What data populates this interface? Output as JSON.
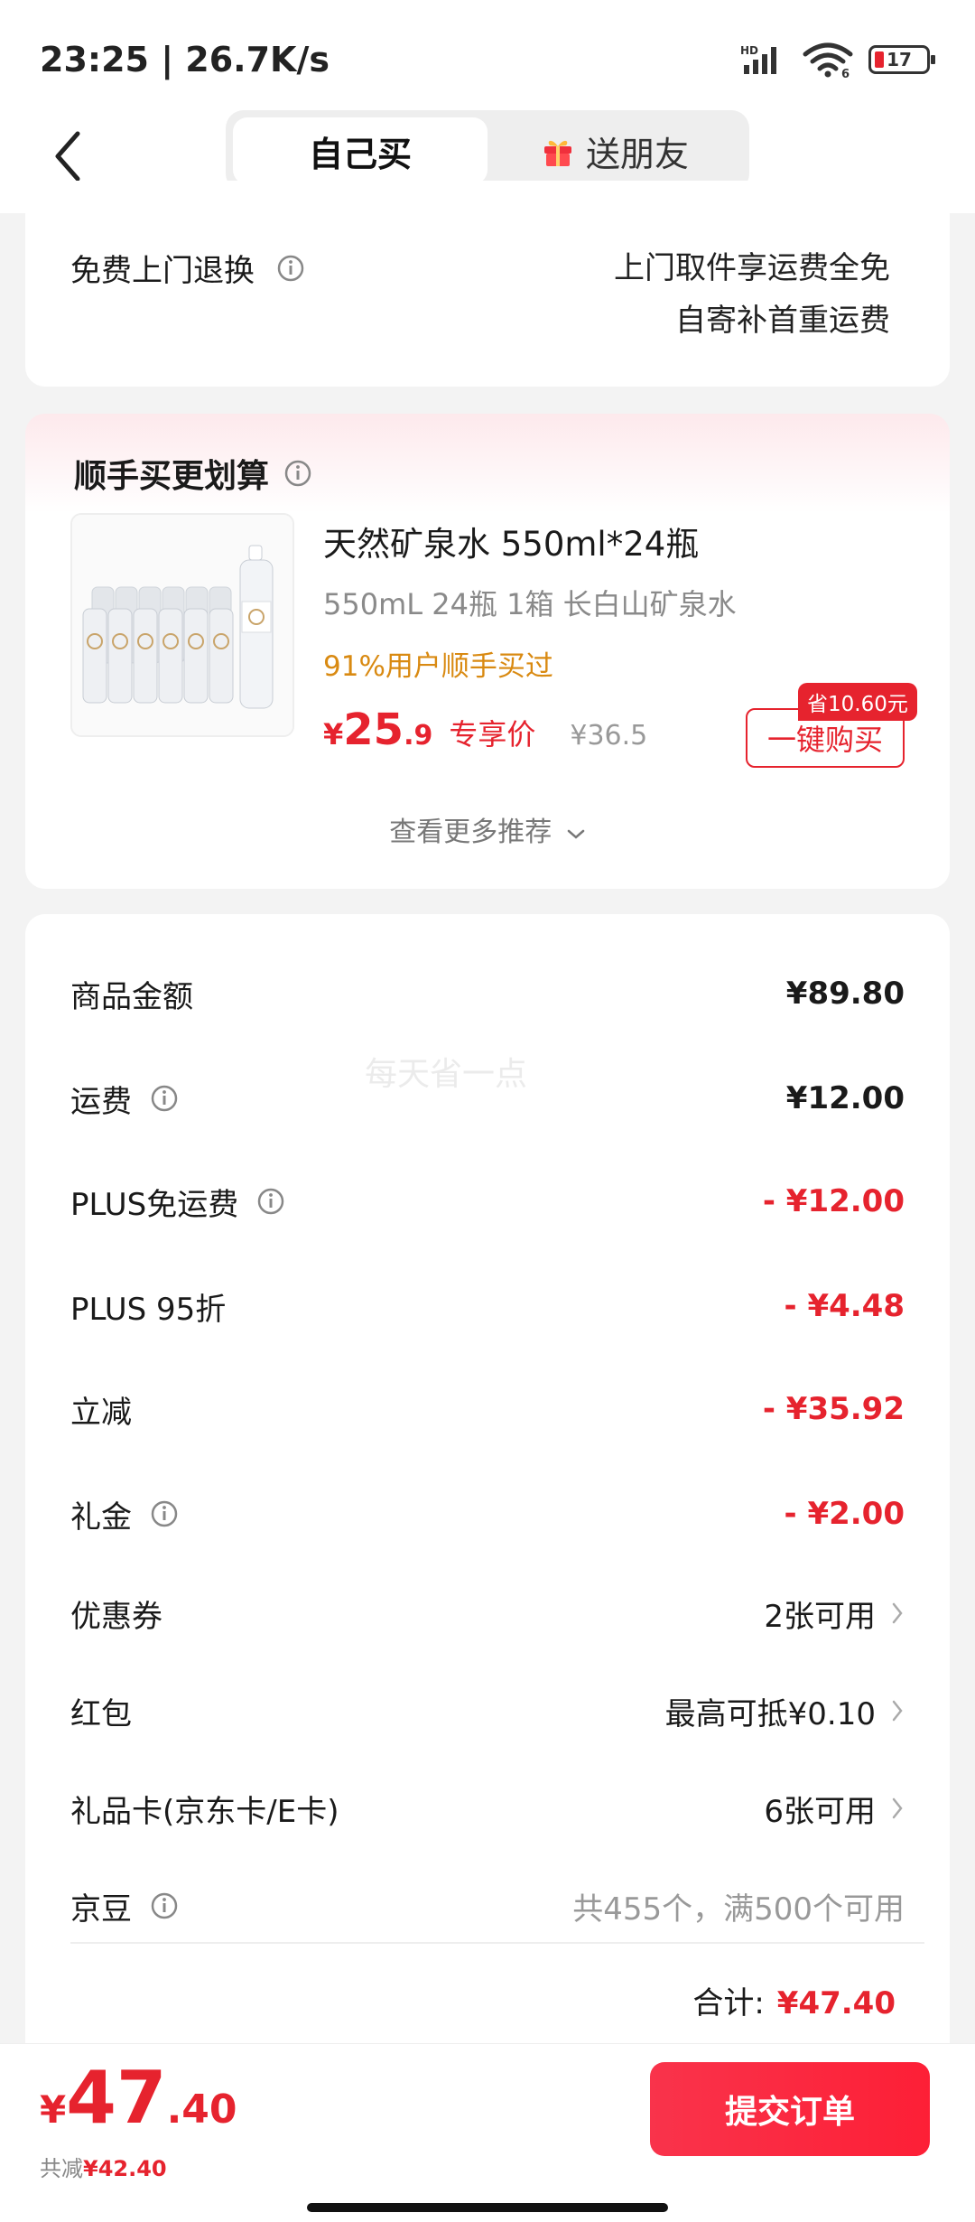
{
  "status_bar": {
    "time_speed": "23:25 | 26.7K/s",
    "network_label": "HD",
    "battery_level": "17",
    "wifi_tag": "6"
  },
  "header": {
    "tabs": [
      {
        "label": "自己买",
        "active": true
      },
      {
        "label": "送朋友",
        "active": false
      }
    ]
  },
  "return_service": {
    "title": "免费上门退换",
    "line1": "上门取件享运费全免",
    "line2": "自寄补首重运费"
  },
  "recommend": {
    "title": "顺手买更划算",
    "product": {
      "name": "天然矿泉水 550ml*24瓶",
      "spec": "550mL 24瓶 1箱 长白山矿泉水",
      "tag": "91%用户顺手买过",
      "price_symbol": "¥",
      "price_int": "25",
      "price_dec": ".9",
      "price_label": "专享价",
      "original_price": "¥36.5",
      "save_badge": "省10.60元",
      "buy_label": "一键购买"
    },
    "more_label": "查看更多推荐"
  },
  "costs": {
    "watermark": "每天省一点",
    "rows": [
      {
        "label": "商品金额",
        "value": "¥89.80"
      },
      {
        "label": "运费",
        "value": "¥12.00"
      },
      {
        "label": "PLUS免运费",
        "value": "- ¥12.00"
      },
      {
        "label": "PLUS 95折",
        "value": "- ¥4.48"
      },
      {
        "label": "立减",
        "value": "- ¥35.92"
      },
      {
        "label": "礼金",
        "value": "- ¥2.00"
      },
      {
        "label": "优惠券",
        "value": "2张可用"
      },
      {
        "label": "红包",
        "value": "最高可抵¥0.10"
      },
      {
        "label": "礼品卡(京东卡/E卡)",
        "value": "6张可用"
      },
      {
        "label": "京豆",
        "value": "共455个，满500个可用"
      }
    ],
    "total_label": "合计:",
    "total_value": "¥47.40"
  },
  "bottom": {
    "pay_symbol": "¥",
    "pay_int": "47",
    "pay_dec": ".40",
    "saved_label": "共减",
    "saved_value": "¥42.40",
    "submit_label": "提交订单"
  },
  "colors": {
    "accent_red": "#e6232e",
    "tag_orange": "#d98a12"
  }
}
